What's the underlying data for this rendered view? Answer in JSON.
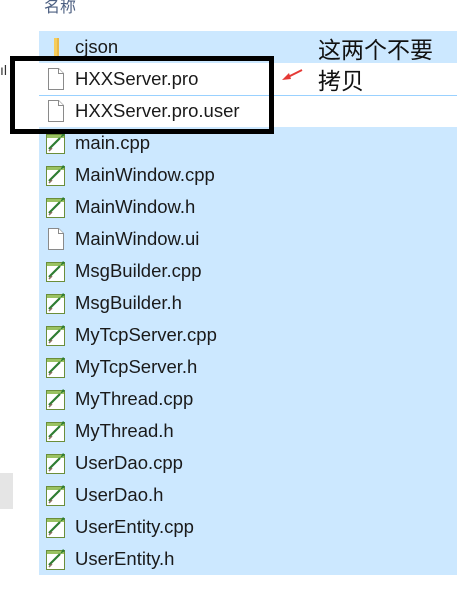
{
  "list": {
    "column_header": "名称",
    "files": [
      {
        "name": "cjson",
        "icon": "folder-icon",
        "selected": true
      },
      {
        "name": "HXXServer.pro",
        "icon": "blank-file-icon",
        "selected": false
      },
      {
        "name": "HXXServer.pro.user",
        "icon": "blank-file-icon",
        "selected": false
      },
      {
        "name": "main.cpp",
        "icon": "code-file-icon",
        "selected": true
      },
      {
        "name": "MainWindow.cpp",
        "icon": "code-file-icon",
        "selected": true
      },
      {
        "name": "MainWindow.h",
        "icon": "code-file-icon",
        "selected": true
      },
      {
        "name": "MainWindow.ui",
        "icon": "blank-file-icon",
        "selected": true
      },
      {
        "name": "MsgBuilder.cpp",
        "icon": "code-file-icon",
        "selected": true
      },
      {
        "name": "MsgBuilder.h",
        "icon": "code-file-icon",
        "selected": true
      },
      {
        "name": "MyTcpServer.cpp",
        "icon": "code-file-icon",
        "selected": true
      },
      {
        "name": "MyTcpServer.h",
        "icon": "code-file-icon",
        "selected": true
      },
      {
        "name": "MyThread.cpp",
        "icon": "code-file-icon",
        "selected": true
      },
      {
        "name": "MyThread.h",
        "icon": "code-file-icon",
        "selected": true
      },
      {
        "name": "UserDao.cpp",
        "icon": "code-file-icon",
        "selected": true
      },
      {
        "name": "UserDao.h",
        "icon": "code-file-icon",
        "selected": true
      },
      {
        "name": "UserEntity.cpp",
        "icon": "code-file-icon",
        "selected": true
      },
      {
        "name": "UserEntity.h",
        "icon": "code-file-icon",
        "selected": true
      }
    ]
  },
  "annotation": {
    "line1": "这两个不要",
    "line2": "拷贝"
  },
  "colors": {
    "selection": "#cce8ff",
    "highlight_box": "#000000",
    "arrow": "#e53935"
  }
}
